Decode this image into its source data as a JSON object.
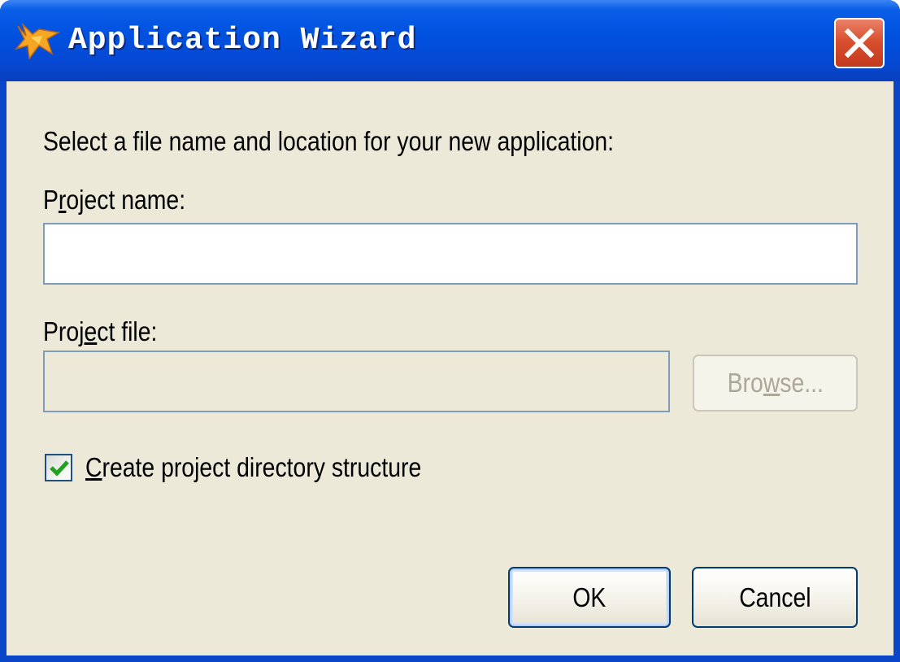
{
  "window": {
    "title": "Application Wizard",
    "icon": "app-wizard-icon",
    "close_icon": "close-icon"
  },
  "form": {
    "instruction": "Select a file name and location for your new application:",
    "project_name": {
      "label_mnemonic_pre": "P",
      "label_mnemonic": "r",
      "label_mnemonic_post": "oject name:",
      "value": ""
    },
    "project_file": {
      "label_mnemonic_pre": "Proj",
      "label_mnemonic": "e",
      "label_mnemonic_post": "ct file:",
      "value": ""
    },
    "browse": {
      "label_pre": "Bro",
      "label_mnemonic": "w",
      "label_post": "se..."
    },
    "create_dir": {
      "checked": true,
      "label_mnemonic": "C",
      "label_post": "reate project directory structure"
    }
  },
  "buttons": {
    "ok_label": "OK",
    "cancel_label": "Cancel"
  },
  "colors": {
    "titlebar": "#0052e0",
    "close_button": "#d9502f",
    "dialog_background": "#ece9d8",
    "checkmark": "#21a121"
  }
}
